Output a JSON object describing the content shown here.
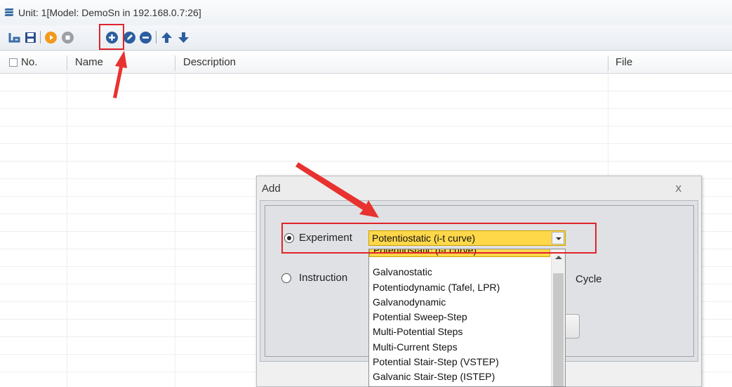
{
  "window": {
    "title": "Unit: 1[Model:  DemoSn in 192.168.0.7:26]"
  },
  "toolbar": {
    "buttons": [
      {
        "name": "tree-icon",
        "color": "#3a6ea5"
      },
      {
        "name": "save-icon",
        "color": "#2c4f8c"
      },
      {
        "name": "run-icon",
        "color": "#f29a1d"
      },
      {
        "name": "stop-icon",
        "color": "#9aa0a6"
      },
      {
        "name": "add-icon",
        "color": "#2c5d9f"
      },
      {
        "name": "edit-icon",
        "color": "#2c5d9f"
      },
      {
        "name": "remove-icon",
        "color": "#2c5d9f"
      },
      {
        "name": "move-up-icon",
        "color": "#2c5d9f"
      },
      {
        "name": "move-down-icon",
        "color": "#2c5d9f"
      }
    ]
  },
  "grid": {
    "columns": [
      "No.",
      "Name",
      "Description",
      "File"
    ],
    "rows": []
  },
  "dialog": {
    "title": "Add",
    "close": "x",
    "experiment_label": "Experiment",
    "instruction_label": "Instruction",
    "cycle_label": "Cycle",
    "experiment_selected": true,
    "combo_value": "Potentiostatic (i-t curve)",
    "options": [
      "Potentiostatic (i-t curve)",
      "Galvanostatic",
      "Potentiodynamic (Tafel, LPR)",
      "Galvanodynamic",
      "Potential Sweep-Step",
      "Multi-Potential Steps",
      "Multi-Current Steps",
      "Potential Stair-Step (VSTEP)",
      "Galvanic Stair-Step (ISTEP)"
    ]
  },
  "colors": {
    "highlight": "#e0232a",
    "selection": "#ffd84a"
  }
}
